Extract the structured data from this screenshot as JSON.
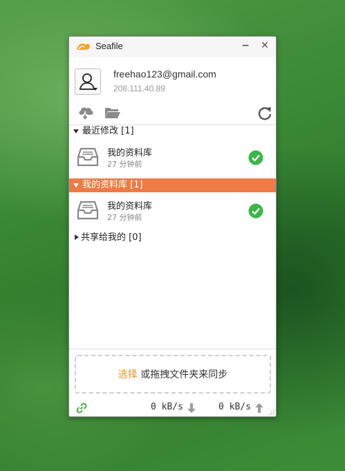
{
  "window": {
    "title": "Seafile",
    "minimize_glyph": "−",
    "close_glyph": "✕"
  },
  "account": {
    "email": "freehao123@gmail.com",
    "server": "208.111.40.89"
  },
  "toolbar": {
    "icons": [
      "cloud-download-icon",
      "folder-open-icon",
      "refresh-icon"
    ]
  },
  "sections": [
    {
      "label": "最近修改 [1]",
      "expanded": true,
      "active": false,
      "repos": [
        {
          "name": "我的资料库",
          "time": "27 分钟前",
          "status": "synced"
        }
      ]
    },
    {
      "label": "我的资料库 [1]",
      "expanded": true,
      "active": true,
      "repos": [
        {
          "name": "我的资料库",
          "time": "27 分钟前",
          "status": "synced"
        }
      ]
    },
    {
      "label": "共享给我的 [0]",
      "expanded": false,
      "active": false,
      "repos": []
    }
  ],
  "dropzone": {
    "link_text": "选择",
    "text": " 或拖拽文件夹来同步"
  },
  "status": {
    "download_speed": "0 kB/s",
    "upload_speed": "0 kB/s"
  },
  "colors": {
    "accent": "#f07a45",
    "link": "#e8912a",
    "synced": "#3cb54a"
  }
}
